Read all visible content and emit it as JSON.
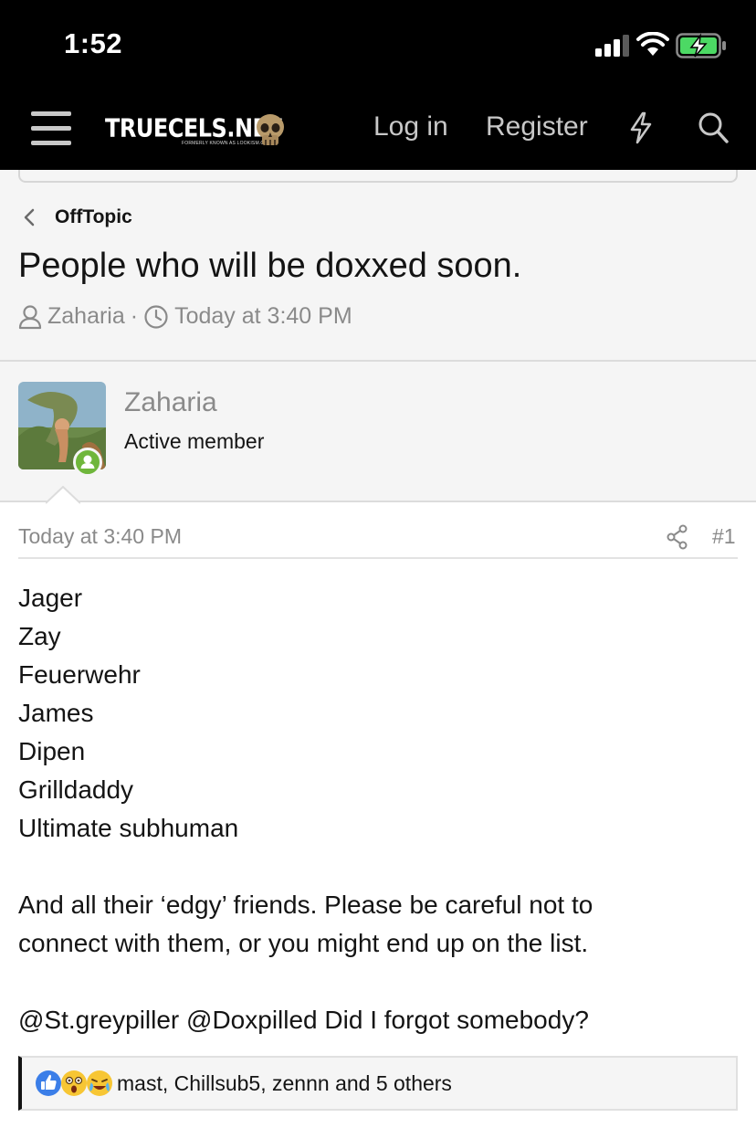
{
  "status": {
    "time": "1:52"
  },
  "nav": {
    "logo_text": "TRUECELS.NET",
    "logo_subtext": "FORMERLY KNOWN AS LOOKISM.CC",
    "login_label": "Log in",
    "register_label": "Register"
  },
  "breadcrumb": {
    "label": "OffTopic"
  },
  "thread": {
    "title": "People who will be doxxed soon.",
    "author": "Zaharia",
    "separator": "·",
    "date": "Today at 3:40 PM"
  },
  "user": {
    "name": "Zaharia",
    "title": "Active member"
  },
  "post": {
    "date": "Today at 3:40 PM",
    "number": "#1",
    "lines": [
      "Jager",
      "Zay",
      "Feuerwehr",
      "James",
      "Dipen",
      "Grilldaddy",
      "Ultimate subhuman",
      "",
      "And all their ‘edgy’ friends. Please be careful not to",
      "connect with them, or you might end up on the list.",
      "",
      "@St.greypiller @Doxpilled Did I forgot somebody?"
    ]
  },
  "reactions": {
    "icons": [
      "like-icon",
      "wow-icon",
      "sad-laugh-icon"
    ],
    "text": "mast, Chillsub5, zennn and 5 others"
  },
  "colors": {
    "nav_bg": "#000000",
    "nav_text": "#c8c8c8",
    "panel_bg": "#f5f5f5",
    "muted_text": "#8a8a8a",
    "online_green": "#6fb63b",
    "like_blue": "#3b7ee8"
  }
}
